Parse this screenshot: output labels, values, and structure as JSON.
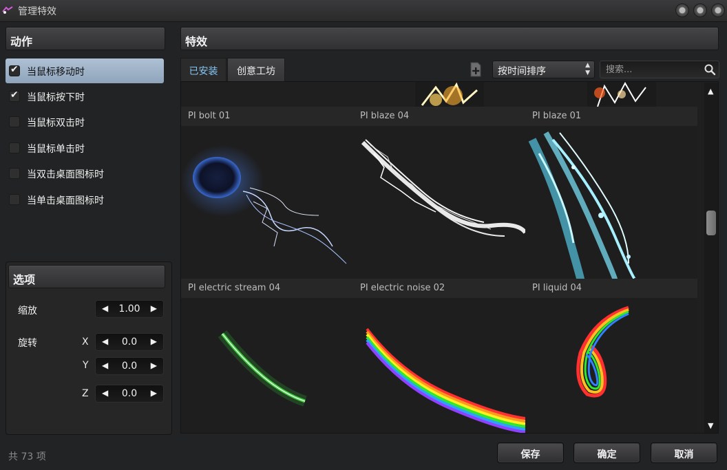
{
  "window": {
    "title": "管理特效"
  },
  "actions_panel": {
    "header": "动作",
    "items": [
      {
        "label": "当鼠标移动时",
        "checked": true,
        "selected": true
      },
      {
        "label": "当鼠标按下时",
        "checked": true,
        "selected": false
      },
      {
        "label": "当鼠标双击时",
        "checked": false,
        "selected": false
      },
      {
        "label": "当鼠标单击时",
        "checked": false,
        "selected": false
      },
      {
        "label": "当双击桌面图标时",
        "checked": false,
        "selected": false
      },
      {
        "label": "当单击桌面图标时",
        "checked": false,
        "selected": false
      }
    ]
  },
  "options_panel": {
    "header": "选项",
    "scale_label": "缩放",
    "scale_value": "1.00",
    "rotate_label": "旋转",
    "x_label": "X",
    "x_value": "0.0",
    "y_label": "Y",
    "y_value": "0.0",
    "z_label": "Z",
    "z_value": "0.0"
  },
  "effects_panel": {
    "header": "特效",
    "tabs": [
      {
        "label": "已安装",
        "active": true
      },
      {
        "label": "创意工坊",
        "active": false
      }
    ],
    "sort": {
      "selected": "按时间排序"
    },
    "search": {
      "placeholder": "搜索..."
    },
    "grid": [
      {
        "name": "PI bolt 01"
      },
      {
        "name": "PI blaze 04"
      },
      {
        "name": "PI blaze 01"
      },
      {
        "name": "PI electric stream 04"
      },
      {
        "name": "PI electric noise 02"
      },
      {
        "name": "PI liquid 04"
      }
    ]
  },
  "footer": {
    "count": "共 73 项",
    "save": "保存",
    "ok": "确定",
    "cancel": "取消"
  },
  "icons": {
    "check": "✔",
    "left": "◀",
    "right": "▶",
    "up": "▲",
    "down": "▼"
  },
  "colors": {
    "selection": "#9fb3c9",
    "active_tab_text": "#86c8f5"
  }
}
